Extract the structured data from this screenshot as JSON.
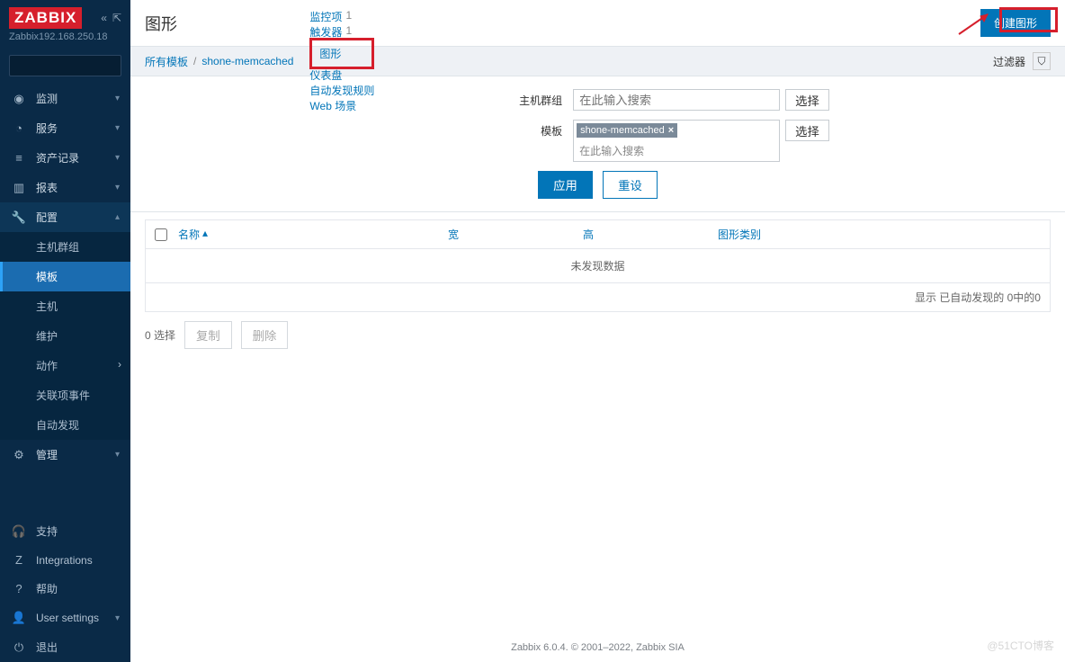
{
  "sidebar": {
    "logo": "ZABBIX",
    "server": "Zabbix192.168.250.18",
    "menu": [
      {
        "icon": "◉",
        "label": "监测",
        "expand": true
      },
      {
        "icon": "◔",
        "label": "服务",
        "expand": true
      },
      {
        "icon": "≡",
        "label": "资产记录",
        "expand": true
      },
      {
        "icon": "▥",
        "label": "报表",
        "expand": true
      },
      {
        "icon": "🔧",
        "label": "配置",
        "expand": true,
        "expanded": true,
        "sub": [
          {
            "label": "主机群组"
          },
          {
            "label": "模板",
            "active": true
          },
          {
            "label": "主机"
          },
          {
            "label": "维护"
          },
          {
            "label": "动作",
            "chev": true
          },
          {
            "label": "关联项事件"
          },
          {
            "label": "自动发现"
          }
        ]
      },
      {
        "icon": "⚙",
        "label": "管理",
        "expand": true
      }
    ],
    "bottom": [
      {
        "icon": "🎧",
        "label": "支持"
      },
      {
        "icon": "Z",
        "label": "Integrations"
      },
      {
        "icon": "?",
        "label": "帮助"
      },
      {
        "icon": "👤",
        "label": "User settings",
        "expand": true
      },
      {
        "icon": "⏻",
        "label": "退出"
      }
    ]
  },
  "page": {
    "title": "图形",
    "create_btn": "创建图形",
    "breadcrumb": [
      "所有模板",
      "shone-memcached"
    ],
    "tabs": [
      {
        "label": "监控项",
        "count": "1"
      },
      {
        "label": "触发器",
        "count": "1"
      },
      {
        "label": "图形",
        "active": true
      },
      {
        "label": "仪表盘"
      },
      {
        "label": "自动发现规则"
      },
      {
        "label": "Web 场景"
      }
    ],
    "filter_label": "过滤器",
    "filter": {
      "hostgroup_label": "主机群组",
      "hostgroup_ph": "在此输入搜索",
      "template_label": "模板",
      "template_tag": "shone-memcached",
      "template_ph": "在此输入搜索",
      "select": "选择",
      "apply": "应用",
      "reset": "重设"
    },
    "table": {
      "cols": {
        "name": "名称",
        "sort": "▴",
        "width": "宽",
        "height": "高",
        "type": "图形类别"
      },
      "nodata": "未发现数据",
      "footer": "显示 已自动发现的 0中的0"
    },
    "sel": {
      "label": "0 选择",
      "copy": "复制",
      "delete": "删除"
    },
    "footer": "Zabbix 6.0.4. © 2001–2022, Zabbix SIA",
    "watermark": "@51CTO博客"
  }
}
